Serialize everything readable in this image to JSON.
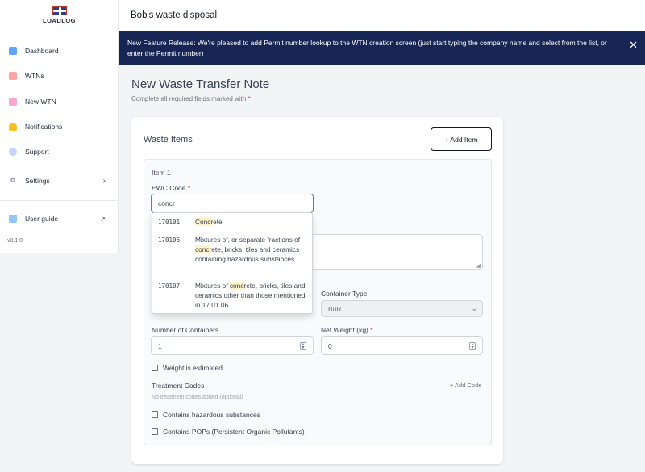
{
  "app": {
    "logo_text": "LOADLOG",
    "version": "v0.1.0"
  },
  "sidebar": {
    "items": [
      {
        "label": "Dashboard",
        "icon": "chart-icon"
      },
      {
        "label": "WTNs",
        "icon": "clipboard-icon"
      },
      {
        "label": "New WTN",
        "icon": "edit-icon"
      },
      {
        "label": "Notifications",
        "icon": "bell-icon"
      },
      {
        "label": "Support",
        "icon": "chat-icon"
      },
      {
        "label": "Settings",
        "icon": "gear-icon"
      }
    ],
    "user_guide": "User guide"
  },
  "header": {
    "title": "Bob's waste disposal"
  },
  "banner": {
    "text": "New Feature Release: We're pleased to add Permit number lookup to the WTN creation screen (just start typing the company name and select from the list, or enter the Permit number)"
  },
  "page": {
    "title": "New Waste Transfer Note",
    "subtitle": "Complete all required fields marked with",
    "required_mark": "*"
  },
  "card": {
    "title": "Waste Items",
    "add_item": "+ Add Item",
    "item_label": "Item 1",
    "ewc_label": "EWC Code",
    "ewc_value": "concr",
    "container_type_label": "Container Type",
    "container_type_value": "Bulk",
    "num_containers_label": "Number of Containers",
    "num_containers_value": "1",
    "net_weight_label": "Net Weight (kg)",
    "net_weight_value": "0",
    "weight_estimated": "Weight is estimated",
    "treatment_codes_label": "Treatment Codes",
    "add_code": "+ Add Code",
    "no_treatment_codes": "No treatment codes added (optional)",
    "hazardous": "Contains hazardous substances",
    "pops": "Contains POPs (Persistent Organic Pollutants)"
  },
  "dropdown": {
    "options": [
      {
        "code": "170101",
        "pre": "",
        "match": "Concr",
        "post": "ete"
      },
      {
        "code": "170106",
        "pre": "Mixtures of, or separate fractions of ",
        "match": "concr",
        "post": "ete, bricks, tiles and ceramics containing hazardous substances"
      },
      {
        "code": "170107",
        "pre": "Mixtures of ",
        "match": "concr",
        "post": "ete, bricks, tiles and ceramics other than those mentioned in 17 01 06"
      }
    ]
  }
}
